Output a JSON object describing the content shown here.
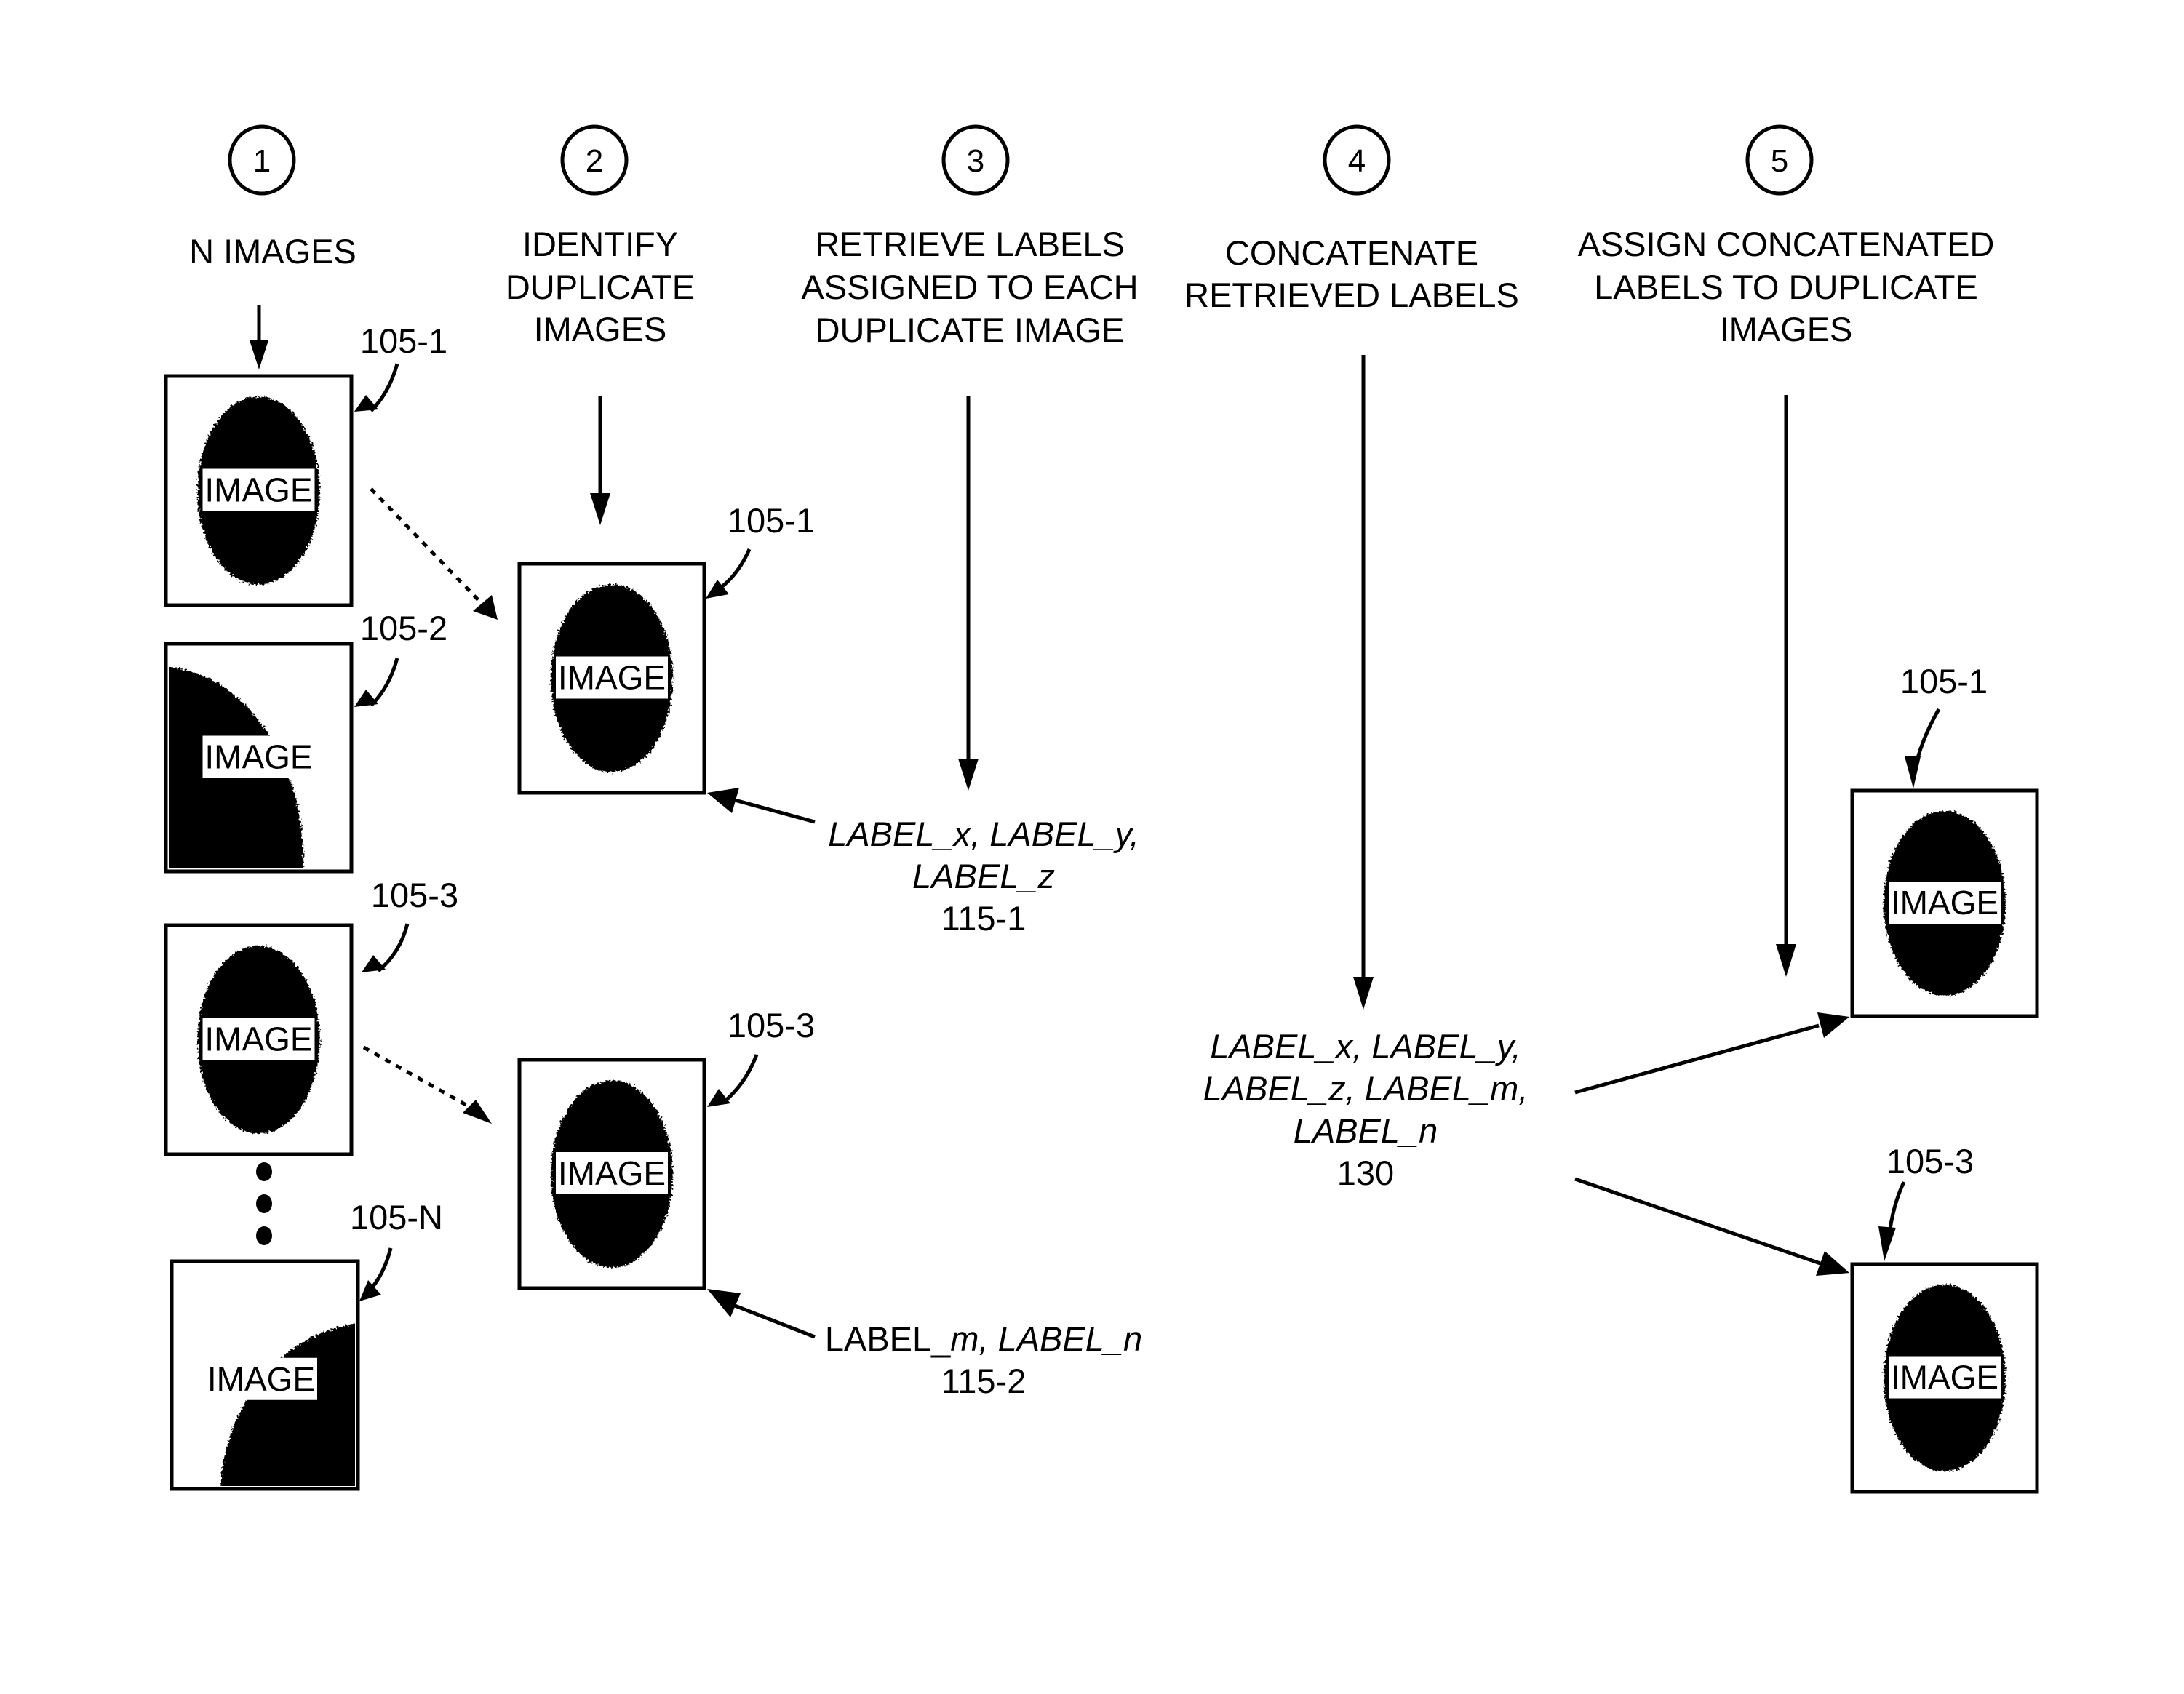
{
  "steps": [
    {
      "number": "1",
      "heading": [
        "N IMAGES"
      ]
    },
    {
      "number": "2",
      "heading": [
        "IDENTIFY",
        "DUPLICATE",
        "IMAGES"
      ]
    },
    {
      "number": "3",
      "heading": [
        "RETRIEVE LABELS",
        "ASSIGNED TO EACH",
        "DUPLICATE IMAGE"
      ]
    },
    {
      "number": "4",
      "heading": [
        "CONCATENATE",
        "RETRIEVED LABELS"
      ]
    },
    {
      "number": "5",
      "heading": [
        "ASSIGN CONCATENATED",
        "LABELS TO DUPLICATE",
        "IMAGES"
      ]
    }
  ],
  "image_tag": "IMAGE",
  "input_images": [
    {
      "ref": "105-1",
      "shape": "full-oval"
    },
    {
      "ref": "105-2",
      "shape": "partial-left"
    },
    {
      "ref": "105-3",
      "shape": "full-oval"
    },
    {
      "ref": "105-N",
      "shape": "partial-right"
    }
  ],
  "ellipsis": "•••",
  "duplicate_images": [
    {
      "ref": "105-1"
    },
    {
      "ref": "105-3"
    }
  ],
  "retrieved_labels": [
    {
      "ref": "115-1",
      "lines": [
        [
          {
            "t": "LABEL_x, LABEL_y,",
            "italic": true
          }
        ],
        [
          {
            "t": "LABEL_z",
            "italic": true
          }
        ]
      ]
    },
    {
      "ref": "115-2",
      "lines": [
        [
          {
            "t": "LABEL_",
            "italic": false
          },
          {
            "t": "m",
            "italic": true
          },
          {
            "t": ", LABEL_n",
            "italic": true
          }
        ]
      ]
    }
  ],
  "concatenated_labels": {
    "ref": "130",
    "lines": [
      "LABEL_x, LABEL_y,",
      "LABEL_z, LABEL_m,",
      "LABEL_n"
    ]
  },
  "output_images": [
    {
      "ref": "105-1"
    },
    {
      "ref": "105-3"
    }
  ]
}
